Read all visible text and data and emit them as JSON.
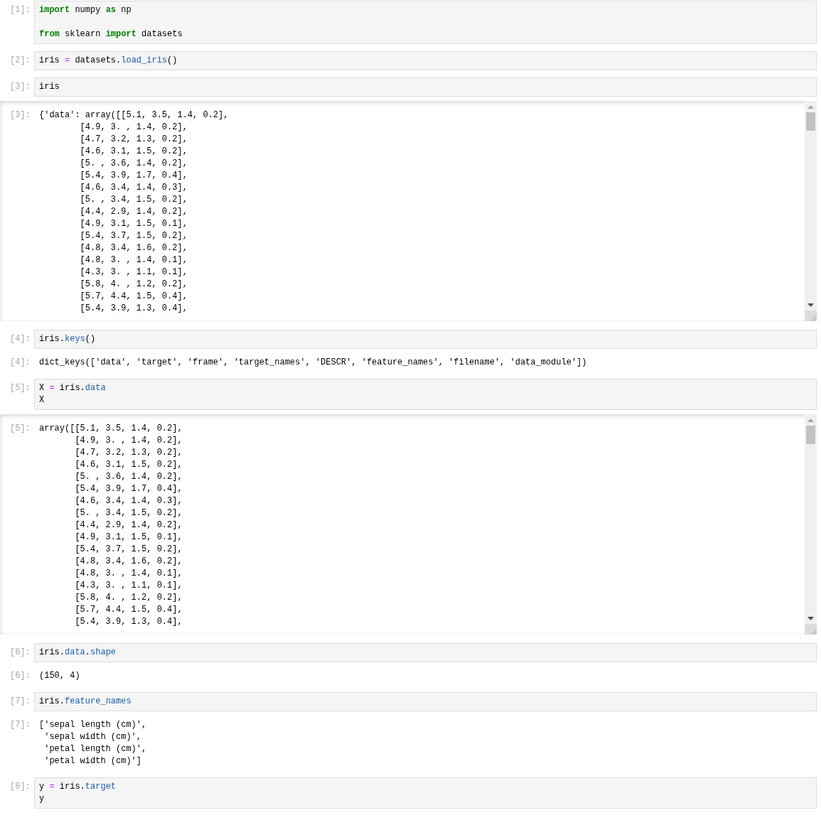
{
  "cells": [
    {
      "kind": "input",
      "prompt": "[1]:",
      "lines": [
        {
          "blank_before": false,
          "tokens": [
            {
              "t": "import",
              "kind": "kw"
            },
            {
              "t": " numpy ",
              "kind": "plain"
            },
            {
              "t": "as",
              "kind": "kw"
            },
            {
              "t": " np",
              "kind": "plain"
            }
          ]
        },
        {
          "blank_before": true,
          "tokens": [
            {
              "t": "from",
              "kind": "kw"
            },
            {
              "t": " sklearn ",
              "kind": "plain"
            },
            {
              "t": "import",
              "kind": "kw"
            },
            {
              "t": " datasets",
              "kind": "plain"
            }
          ]
        }
      ]
    },
    {
      "kind": "input",
      "prompt": "[2]:",
      "lines": [
        {
          "blank_before": false,
          "tokens": [
            {
              "t": "iris ",
              "kind": "plain"
            },
            {
              "t": "=",
              "kind": "op"
            },
            {
              "t": " datasets.",
              "kind": "plain"
            },
            {
              "t": "load_iris",
              "kind": "attr"
            },
            {
              "t": "()",
              "kind": "plain"
            }
          ]
        }
      ]
    },
    {
      "kind": "input",
      "prompt": "[3]:",
      "lines": [
        {
          "blank_before": false,
          "tokens": [
            {
              "t": "iris",
              "kind": "plain"
            }
          ]
        }
      ]
    },
    {
      "kind": "output",
      "prompt": "[3]:",
      "scrolled": true,
      "lines": [
        "{'data': array([[5.1, 3.5, 1.4, 0.2],",
        "        [4.9, 3. , 1.4, 0.2],",
        "        [4.7, 3.2, 1.3, 0.2],",
        "        [4.6, 3.1, 1.5, 0.2],",
        "        [5. , 3.6, 1.4, 0.2],",
        "        [5.4, 3.9, 1.7, 0.4],",
        "        [4.6, 3.4, 1.4, 0.3],",
        "        [5. , 3.4, 1.5, 0.2],",
        "        [4.4, 2.9, 1.4, 0.2],",
        "        [4.9, 3.1, 1.5, 0.1],",
        "        [5.4, 3.7, 1.5, 0.2],",
        "        [4.8, 3.4, 1.6, 0.2],",
        "        [4.8, 3. , 1.4, 0.1],",
        "        [4.3, 3. , 1.1, 0.1],",
        "        [5.8, 4. , 1.2, 0.2],",
        "        [5.7, 4.4, 1.5, 0.4],",
        "        [5.4, 3.9, 1.3, 0.4],"
      ]
    },
    {
      "kind": "input",
      "prompt": "[4]:",
      "lines": [
        {
          "blank_before": false,
          "tokens": [
            {
              "t": "iris.",
              "kind": "plain"
            },
            {
              "t": "keys",
              "kind": "attr"
            },
            {
              "t": "()",
              "kind": "plain"
            }
          ]
        }
      ]
    },
    {
      "kind": "output",
      "prompt": "[4]:",
      "scrolled": false,
      "lines": [
        "dict_keys(['data', 'target', 'frame', 'target_names', 'DESCR', 'feature_names', 'filename', 'data_module'])"
      ]
    },
    {
      "kind": "input",
      "prompt": "[5]:",
      "lines": [
        {
          "blank_before": false,
          "tokens": [
            {
              "t": "X ",
              "kind": "plain"
            },
            {
              "t": "=",
              "kind": "op"
            },
            {
              "t": " iris.",
              "kind": "plain"
            },
            {
              "t": "data",
              "kind": "attr"
            }
          ]
        },
        {
          "blank_before": false,
          "tokens": [
            {
              "t": "X",
              "kind": "plain"
            }
          ]
        }
      ]
    },
    {
      "kind": "output",
      "prompt": "[5]:",
      "scrolled": true,
      "lines": [
        "array([[5.1, 3.5, 1.4, 0.2],",
        "       [4.9, 3. , 1.4, 0.2],",
        "       [4.7, 3.2, 1.3, 0.2],",
        "       [4.6, 3.1, 1.5, 0.2],",
        "       [5. , 3.6, 1.4, 0.2],",
        "       [5.4, 3.9, 1.7, 0.4],",
        "       [4.6, 3.4, 1.4, 0.3],",
        "       [5. , 3.4, 1.5, 0.2],",
        "       [4.4, 2.9, 1.4, 0.2],",
        "       [4.9, 3.1, 1.5, 0.1],",
        "       [5.4, 3.7, 1.5, 0.2],",
        "       [4.8, 3.4, 1.6, 0.2],",
        "       [4.8, 3. , 1.4, 0.1],",
        "       [4.3, 3. , 1.1, 0.1],",
        "       [5.8, 4. , 1.2, 0.2],",
        "       [5.7, 4.4, 1.5, 0.4],",
        "       [5.4, 3.9, 1.3, 0.4],"
      ]
    },
    {
      "kind": "input",
      "prompt": "[6]:",
      "lines": [
        {
          "blank_before": false,
          "tokens": [
            {
              "t": "iris.",
              "kind": "plain"
            },
            {
              "t": "data",
              "kind": "attr"
            },
            {
              "t": ".",
              "kind": "plain"
            },
            {
              "t": "shape",
              "kind": "attr"
            }
          ]
        }
      ]
    },
    {
      "kind": "output",
      "prompt": "[6]:",
      "scrolled": false,
      "lines": [
        "(150, 4)"
      ]
    },
    {
      "kind": "input",
      "prompt": "[7]:",
      "lines": [
        {
          "blank_before": false,
          "tokens": [
            {
              "t": "iris.",
              "kind": "plain"
            },
            {
              "t": "feature_names",
              "kind": "attr"
            }
          ]
        }
      ]
    },
    {
      "kind": "output",
      "prompt": "[7]:",
      "scrolled": false,
      "lines": [
        "['sepal length (cm)',",
        " 'sepal width (cm)',",
        " 'petal length (cm)',",
        " 'petal width (cm)']"
      ]
    },
    {
      "kind": "input",
      "prompt": "[8]:",
      "lines": [
        {
          "blank_before": false,
          "tokens": [
            {
              "t": "y ",
              "kind": "plain"
            },
            {
              "t": "=",
              "kind": "op"
            },
            {
              "t": " iris.",
              "kind": "plain"
            },
            {
              "t": "target",
              "kind": "attr"
            }
          ]
        },
        {
          "blank_before": false,
          "tokens": [
            {
              "t": "y",
              "kind": "plain"
            }
          ]
        }
      ]
    }
  ]
}
